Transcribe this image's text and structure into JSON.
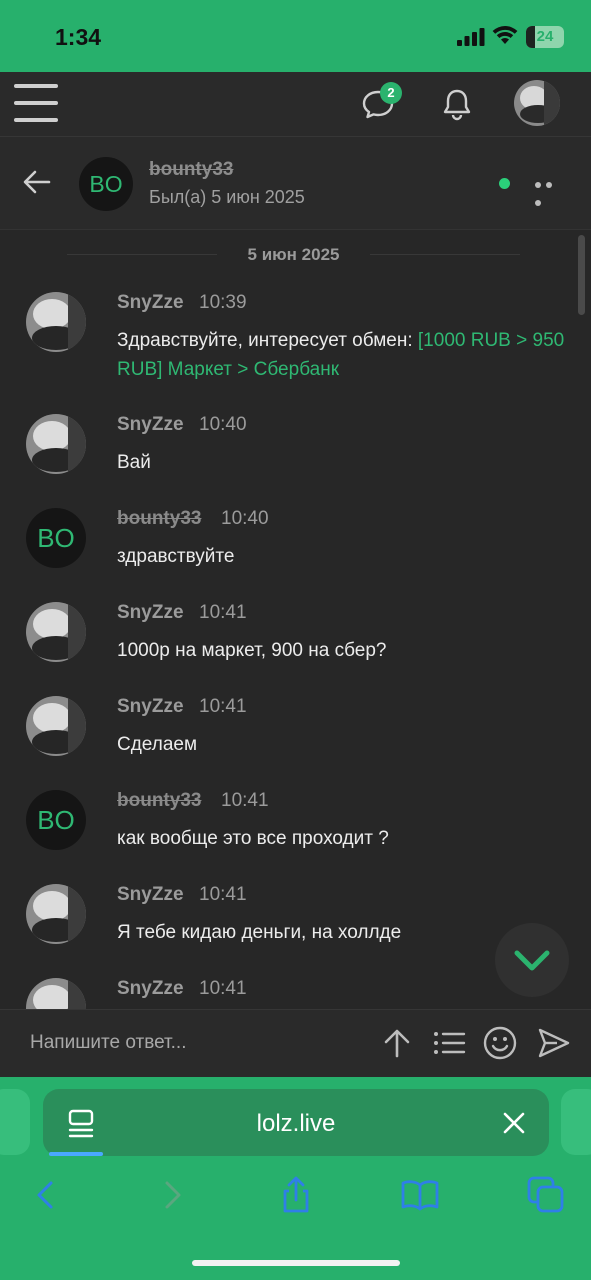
{
  "status_bar": {
    "time": "1:34",
    "battery": "24",
    "battery_level": 0.24
  },
  "app_header": {
    "notifications_badge": "2"
  },
  "conversation": {
    "avatar_initials": "BO",
    "name": "bounty33",
    "last_seen": "Был(а) 5 июн 2025",
    "online": true
  },
  "date_separator": "5 июн 2025",
  "messages": [
    {
      "author": "SnyZze",
      "time": "10:39",
      "text": "Здравствуйте, интересует обмен: ",
      "link": "[1000 RUB > 950 RUB] Маркет > Сбербанк"
    },
    {
      "author": "SnyZze",
      "time": "10:40",
      "text": "Вай"
    },
    {
      "author": "bounty33",
      "time": "10:40",
      "text": "здравствуйте",
      "avatar_initials": "BO"
    },
    {
      "author": "SnyZze",
      "time": "10:41",
      "text": "1000р на маркет, 900 на сбер?"
    },
    {
      "author": "SnyZze",
      "time": "10:41",
      "text": "Сделаем"
    },
    {
      "author": "bounty33",
      "time": "10:41",
      "text": "как вообще это все проходит ?",
      "avatar_initials": "BO"
    },
    {
      "author": "SnyZze",
      "time": "10:41",
      "text": "Я тебе кидаю деньги, на холлде"
    },
    {
      "author": "SnyZze",
      "time": "10:41",
      "text": ""
    }
  ],
  "compose": {
    "placeholder": "Напишите ответ..."
  },
  "browser": {
    "url": "lolz.live"
  },
  "colors": {
    "accent": "#27b06c",
    "link": "#2fb873",
    "background": "#272727"
  },
  "icons": [
    "menu-icon",
    "chat-icon",
    "bell-icon",
    "back-arrow-icon",
    "more-icon",
    "chevron-down-icon",
    "upload-icon",
    "list-icon",
    "smiley-icon",
    "send-icon",
    "tab-page-icon",
    "close-icon",
    "back-icon",
    "forward-icon",
    "share-icon",
    "bookmarks-icon",
    "tabs-icon"
  ]
}
